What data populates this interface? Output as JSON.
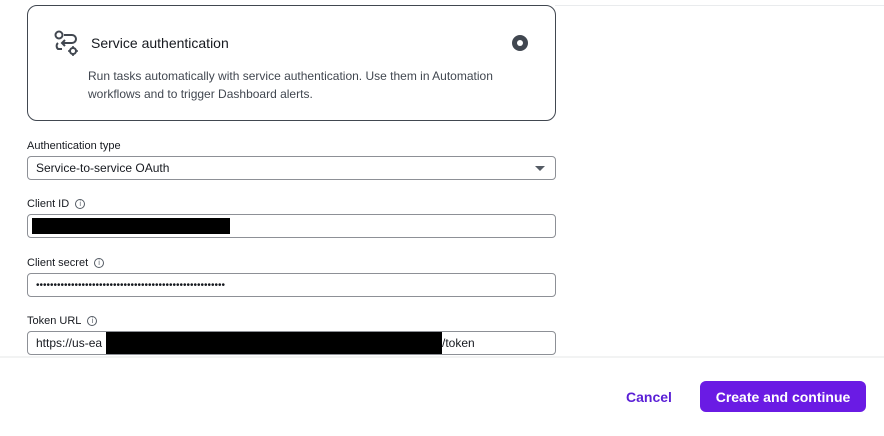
{
  "card": {
    "title": "Service authentication",
    "description": "Run tasks automatically with service authentication. Use them in Automation workflows and to trigger Dashboard alerts.",
    "selected": true,
    "icon": "service-auth-icon"
  },
  "fields": {
    "auth_type": {
      "label": "Authentication type",
      "value": "Service-to-service OAuth"
    },
    "client_id": {
      "label": "Client ID",
      "info_icon": "info-icon",
      "value": ""
    },
    "client_secret": {
      "label": "Client secret",
      "info_icon": "info-icon",
      "value": "••••••••••••••••••••••••••••••••••••••••••••••••••••••"
    },
    "token_url": {
      "label": "Token URL",
      "info_icon": "info-icon",
      "value_prefix": "https://us-ea",
      "value_suffix": "/token"
    }
  },
  "footer": {
    "cancel_label": "Cancel",
    "primary_label": "Create and continue"
  },
  "colors": {
    "primary": "#6a1be4",
    "link": "#5a1fd6",
    "border": "#8d9096",
    "card_border": "#414750"
  }
}
